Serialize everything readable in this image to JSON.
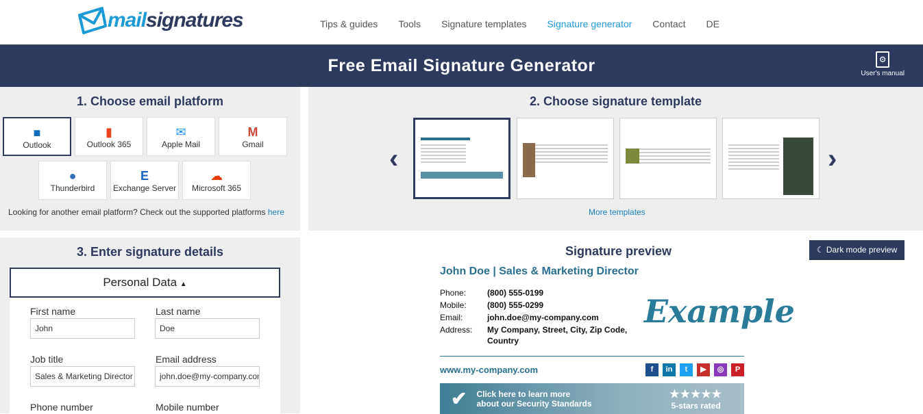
{
  "header": {
    "logo_part1": "mail",
    "logo_part2": "signatures",
    "nav": [
      "Tips & guides",
      "Tools",
      "Signature templates",
      "Signature generator",
      "Contact",
      "DE"
    ],
    "active_nav": "Signature generator"
  },
  "banner": {
    "title": "Free Email Signature Generator",
    "manual_label": "User's manual"
  },
  "platforms": {
    "title": "1. Choose email platform",
    "items": [
      {
        "label": "Outlook",
        "icon": "outlook-icon",
        "color": "#0f6cbd"
      },
      {
        "label": "Outlook 365",
        "icon": "office-icon",
        "color": "#e8431f"
      },
      {
        "label": "Apple Mail",
        "icon": "apple-mail-icon",
        "color": "#1e90ff"
      },
      {
        "label": "Gmail",
        "icon": "gmail-icon",
        "color": "#d44638"
      },
      {
        "label": "Thunderbird",
        "icon": "thunderbird-icon",
        "color": "#2f6fb6"
      },
      {
        "label": "Exchange Server",
        "icon": "exchange-icon",
        "color": "#1565c0"
      },
      {
        "label": "Microsoft 365",
        "icon": "cloud-icon",
        "color": "#eb3c00"
      }
    ],
    "selected": "Outlook",
    "footer_text": "Looking for another email platform? Check out the supported platforms ",
    "footer_link": "here"
  },
  "templates": {
    "title": "2. Choose signature template",
    "more": "More templates"
  },
  "details": {
    "title": "3. Enter signature details",
    "section": "Personal Data",
    "fields": [
      {
        "label": "First name",
        "value": "John"
      },
      {
        "label": "Last name",
        "value": "Doe"
      },
      {
        "label": "Job title",
        "value": "Sales & Marketing Director"
      },
      {
        "label": "Email address",
        "value": "john.doe@my-company.com"
      },
      {
        "label": "Phone number",
        "value": ""
      },
      {
        "label": "Mobile number",
        "value": ""
      }
    ]
  },
  "preview": {
    "title": "Signature preview",
    "dark_mode": "Dark mode preview",
    "name_line": "John Doe | Sales & Marketing Director",
    "rows": [
      {
        "k": "Phone:",
        "v": "(800) 555-0199"
      },
      {
        "k": "Mobile:",
        "v": "(800) 555-0299"
      },
      {
        "k": "Email:",
        "v": "john.doe@my-company.com"
      },
      {
        "k": "Address:",
        "v": "My Company, Street, City, Zip Code, Country"
      }
    ],
    "logo": "Example",
    "website": "www.my-company.com",
    "social": [
      {
        "icon": "facebook-icon",
        "glyph": "f",
        "color": "#1f4e8c"
      },
      {
        "icon": "linkedin-icon",
        "glyph": "in",
        "color": "#0e76a8"
      },
      {
        "icon": "twitter-icon",
        "glyph": "t",
        "color": "#1da1f2"
      },
      {
        "icon": "youtube-icon",
        "glyph": "▶",
        "color": "#c4302b"
      },
      {
        "icon": "instagram-icon",
        "glyph": "◎",
        "color": "#8a3ab9"
      },
      {
        "icon": "pinterest-icon",
        "glyph": "P",
        "color": "#cb2027"
      }
    ],
    "banner_line1": "Click here to learn more",
    "banner_line2": "about our Security Standards",
    "stars": "★★★★★",
    "rating": "5-stars rated"
  }
}
